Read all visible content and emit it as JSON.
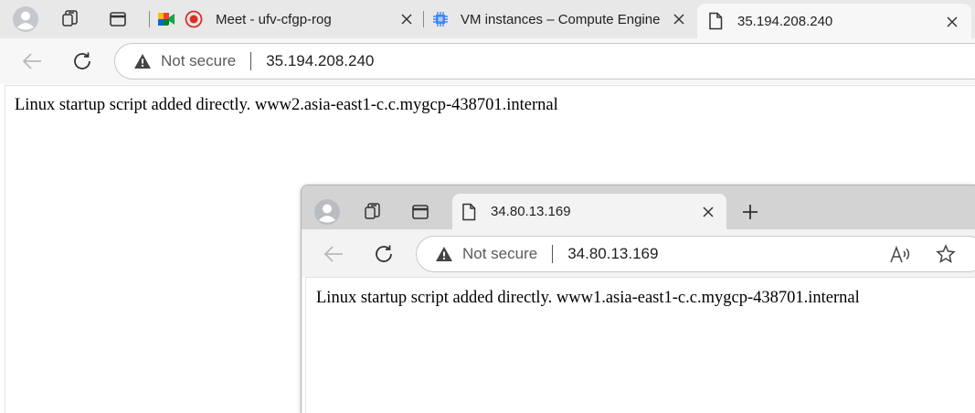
{
  "back_window": {
    "tabs": [
      {
        "title": "Meet - ufv-cfgp-rog",
        "icon": "google-meet-icon",
        "recording_indicator": "recording-icon"
      },
      {
        "title": "VM instances – Compute Engine –",
        "icon": "compute-engine-icon"
      },
      {
        "title": "35.194.208.240",
        "icon": "page-icon",
        "active": true
      }
    ],
    "address_bar": {
      "security_label": "Not secure",
      "url": "35.194.208.240"
    },
    "page_text": "Linux startup script added directly. www2.asia-east1-c.c.mygcp-438701.internal"
  },
  "front_window": {
    "tabs": [
      {
        "title": "34.80.13.169",
        "icon": "page-icon",
        "active": true
      }
    ],
    "address_bar": {
      "security_label": "Not secure",
      "url": "34.80.13.169"
    },
    "page_text": "Linux startup script added directly. www1.asia-east1-c.c.mygcp-438701.internal"
  },
  "colors": {
    "tabbar_bg": "#e8e8e8",
    "toolbar_bg": "#f7f7f7",
    "record_red": "#d93025"
  }
}
